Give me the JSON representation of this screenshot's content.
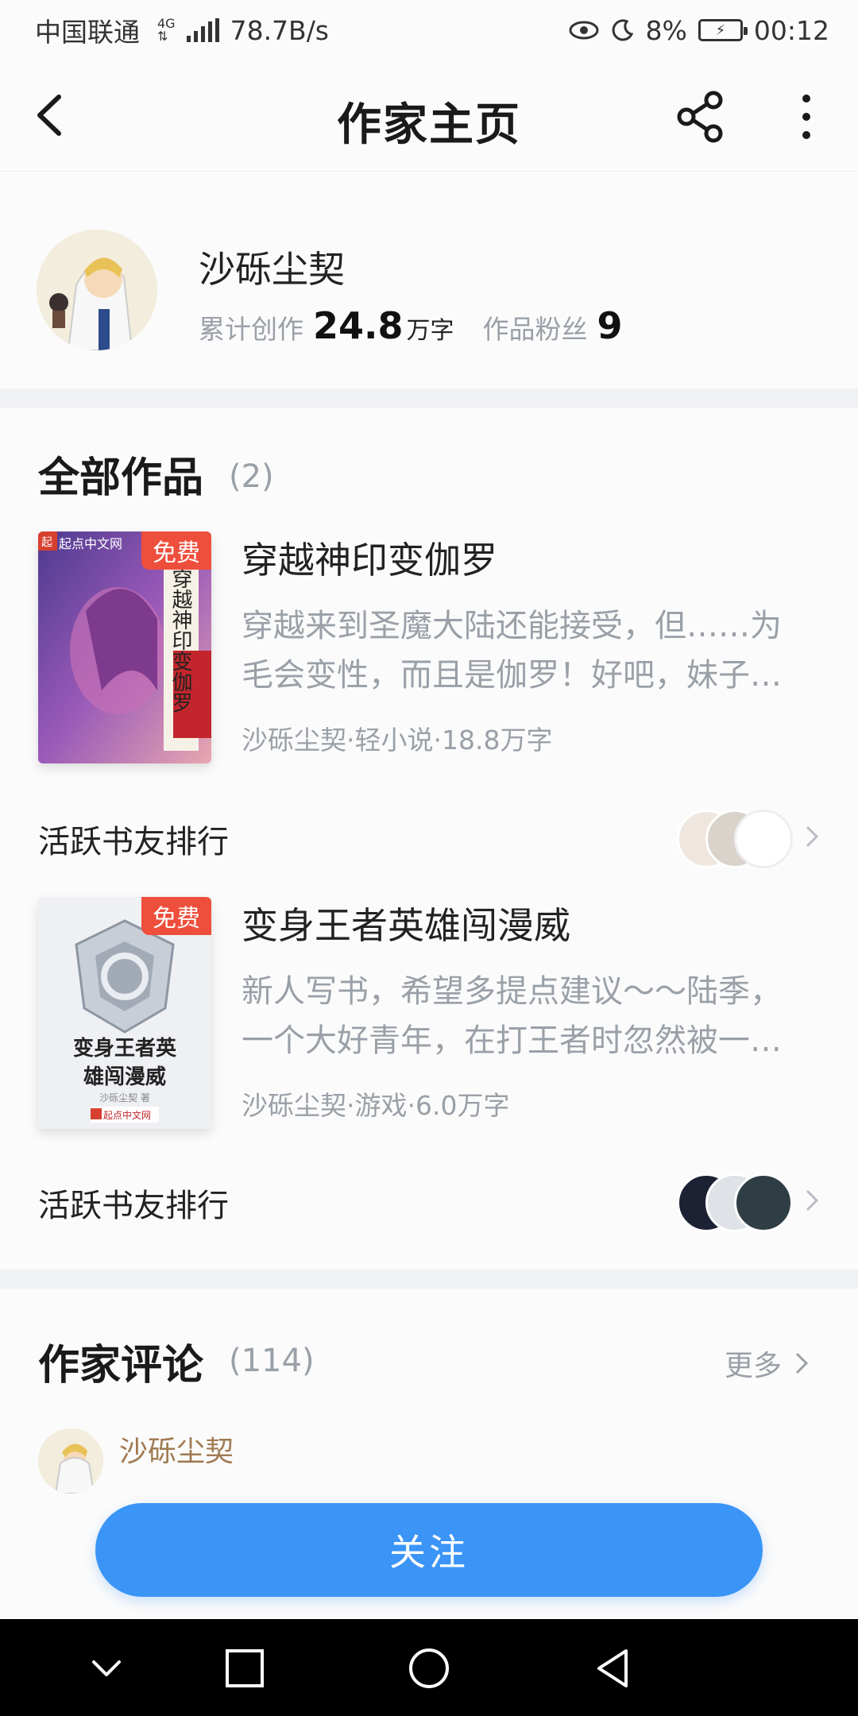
{
  "status_bar": {
    "carrier": "中国联通",
    "network_type": "4G",
    "speed": "78.7B/s",
    "battery": "8%",
    "time": "00:12"
  },
  "nav": {
    "title": "作家主页"
  },
  "author": {
    "name": "沙砾尘契",
    "stat1_label": "累计创作",
    "stat1_value": "24.8",
    "stat1_unit": "万字",
    "stat2_label": "作品粉丝",
    "stat2_value": "9"
  },
  "works": {
    "title": "全部作品",
    "count": "(2)",
    "books": [
      {
        "badge": "免费",
        "cover_brand": "起点中文网",
        "cover_text": "穿越神印变伽罗",
        "title": "穿越神印变伽罗",
        "desc_line1": "穿越来到圣魔大陆还能接受，但……为",
        "desc_line2": "毛会变性，而且是伽罗！好吧，妹子…",
        "meta": "沙砾尘契·轻小说·18.8万字",
        "rank_label": "活跃书友排行"
      },
      {
        "badge": "免费",
        "cover_title_1": "变身王者英",
        "cover_title_2": "雄闯漫威",
        "cover_author": "沙砾尘契 著",
        "cover_brand": "起点中文网",
        "title": "变身王者英雄闯漫威",
        "desc_line1": "新人写书，希望多提点建议～～陆季，",
        "desc_line2": "一个大好青年，在打王者时忽然被一…",
        "meta": "沙砾尘契·游戏·6.0万字",
        "rank_label": "活跃书友排行"
      }
    ]
  },
  "comments": {
    "title": "作家评论",
    "count": "(114)",
    "more": "更多",
    "first_commenter": "沙砾尘契"
  },
  "follow_button": "关注",
  "colors": {
    "accent": "#3a95f7",
    "badge": "#ee4f3c",
    "muted": "#9aa0a8"
  }
}
